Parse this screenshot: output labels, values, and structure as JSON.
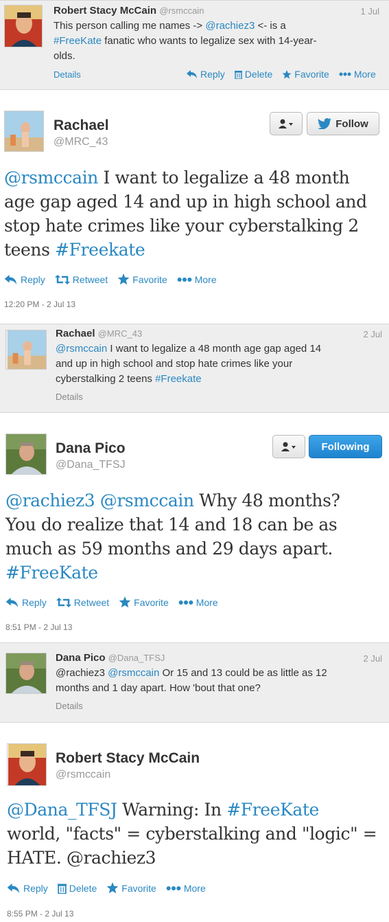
{
  "colors": {
    "link": "#2a88c2",
    "gray_bg": "#eeeeee",
    "follow_blue": "#1f83cf"
  },
  "actions": {
    "reply": "Reply",
    "retweet": "Retweet",
    "delete": "Delete",
    "favorite": "Favorite",
    "more": "More",
    "details": "Details"
  },
  "buttons": {
    "follow": "Follow",
    "following": "Following"
  },
  "tweet1": {
    "name": "Robert Stacy McCain",
    "handle": "@rsmccain",
    "date": "1 Jul",
    "line1": "This person calling me names -> ",
    "mention": "@rachiez3",
    "line1b": " <- is a",
    "hashtag": "#FreeKate",
    "line2": " fanatic who wants to legalize sex with 14-year-",
    "line3": "olds."
  },
  "tweet2": {
    "name": "Rachael",
    "handle": "@MRC_43",
    "mention": "@rsmccain",
    "text1": " I want to legalize a 48 month",
    "text2": "age gap aged 14 and up in high school and",
    "text3": "stop hate crimes like your cyberstalking 2",
    "text4": "teens ",
    "hashtag": "#Freekate",
    "timestamp": "12:20 PM - 2 Jul 13"
  },
  "reply2": {
    "name": "Rachael",
    "handle": "@MRC_43",
    "date": "2 Jul",
    "mention": "@rsmccain",
    "text1": " I want to legalize a 48 month age gap aged 14",
    "text2": "and up in high school and stop hate crimes like your",
    "text3": "cyberstalking 2 teens ",
    "hashtag": "#Freekate"
  },
  "tweet3": {
    "name": "Dana Pico",
    "handle": "@Dana_TFSJ",
    "mention1": "@rachiez3",
    "mention2": "@rsmccain",
    "text1": " Why 48 months?",
    "text2": "You do realize that 14 and 18 can be as",
    "text3": "much as 59 months and 29 days apart.",
    "hashtag": "#FreeKate",
    "timestamp": "8:51 PM - 2 Jul 13"
  },
  "reply3": {
    "name": "Dana Pico",
    "handle": "@Dana_TFSJ",
    "date": "2 Jul",
    "mention1": "@rachiez3",
    "mention2": "@rsmccain",
    "text1": " Or 15 and 13 could be as little as 12",
    "text2": "months and 1 day apart. How 'bout that one?"
  },
  "tweet4": {
    "name": "Robert Stacy McCain",
    "handle": "@rsmccain",
    "mention": "@Dana_TFSJ",
    "text1": " Warning: In ",
    "hashtag": "#FreeKate",
    "text2": "world, \"facts\" = cyberstalking and \"logic\" =",
    "text3": "HATE. @rachiez3",
    "timestamp": "8:55 PM - 2 Jul 13"
  }
}
